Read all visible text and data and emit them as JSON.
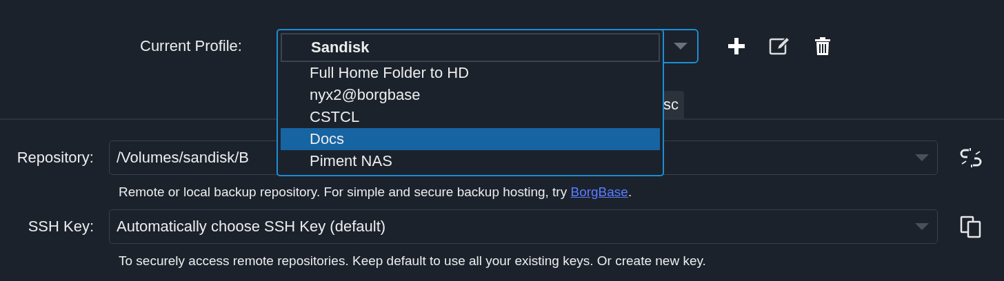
{
  "profile": {
    "label": "Current Profile:",
    "popup_items": [
      {
        "label": "Sandisk",
        "current": true,
        "selected": false
      },
      {
        "label": "Full Home Folder to HD",
        "current": false,
        "selected": false
      },
      {
        "label": "nyx2@borgbase",
        "current": false,
        "selected": false
      },
      {
        "label": "CSTCL",
        "current": false,
        "selected": false
      },
      {
        "label": "Docs",
        "current": false,
        "selected": true
      },
      {
        "label": "Piment NAS",
        "current": false,
        "selected": false
      }
    ]
  },
  "tabs": [
    {
      "label": "sc",
      "selected": false
    }
  ],
  "repository": {
    "label": "Repository:",
    "value": "/Volumes/sandisk/B",
    "help": "Remote or local backup repository. For simple and secure backup hosting, try ",
    "link": "BorgBase",
    "help_end": "."
  },
  "ssh_key": {
    "label": "SSH Key:",
    "value": "Automatically choose SSH Key (default)",
    "help": "To securely access remote repositories. Keep default to use all your existing keys. Or create new key."
  }
}
